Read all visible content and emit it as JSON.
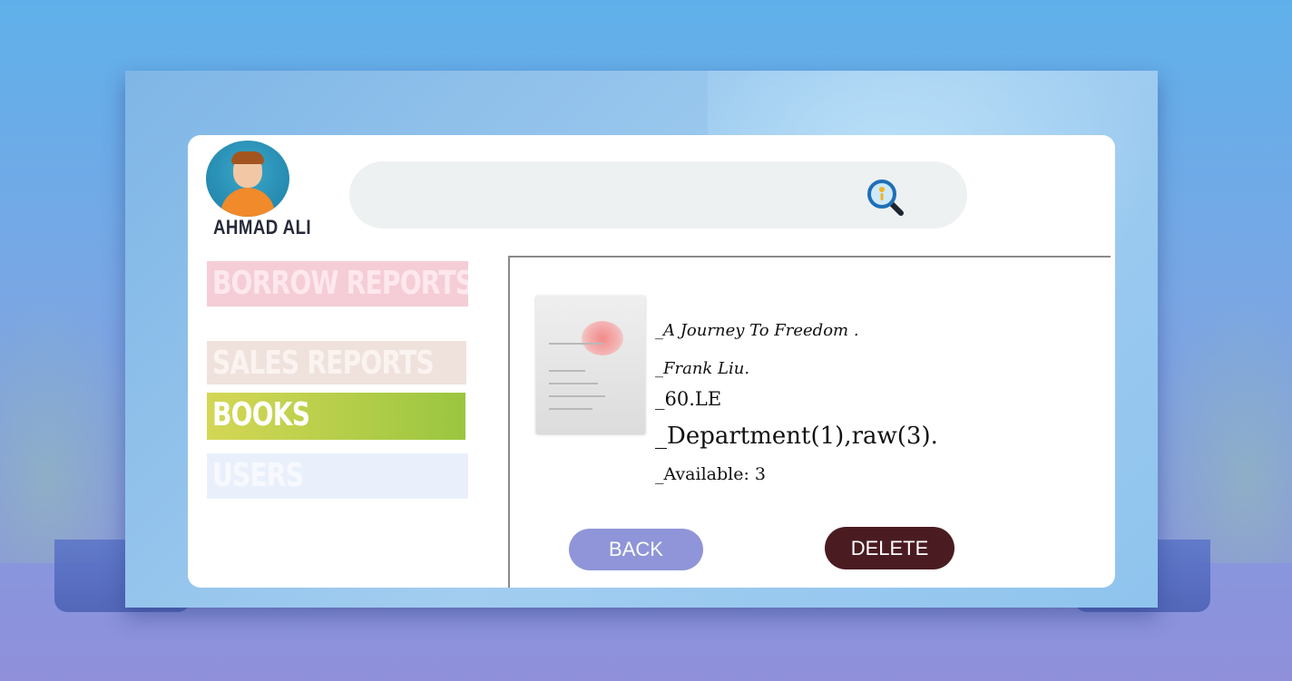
{
  "user": {
    "name": "AHMAD ALI"
  },
  "search": {
    "placeholder": "",
    "value": "",
    "icon": "search-icon"
  },
  "nav": {
    "items": [
      {
        "label": "BORROW REPORTS"
      },
      {
        "label": "SALES REPORTS"
      },
      {
        "label": "BOOKS",
        "active": true
      },
      {
        "label": "USERS"
      }
    ]
  },
  "book": {
    "title": "_A Journey To Freedom .",
    "author": "_Frank Liu.",
    "price": "_60.LE",
    "location": "_Department(1),raw(3).",
    "availability": "_Available: 3"
  },
  "actions": {
    "back_label": "BACK",
    "delete_label": "DELETE"
  },
  "colors": {
    "background": "#6fa8e6",
    "books_active": "#b5cf48",
    "back_button": "#8f95d8",
    "delete_button": "#4a1c22"
  }
}
